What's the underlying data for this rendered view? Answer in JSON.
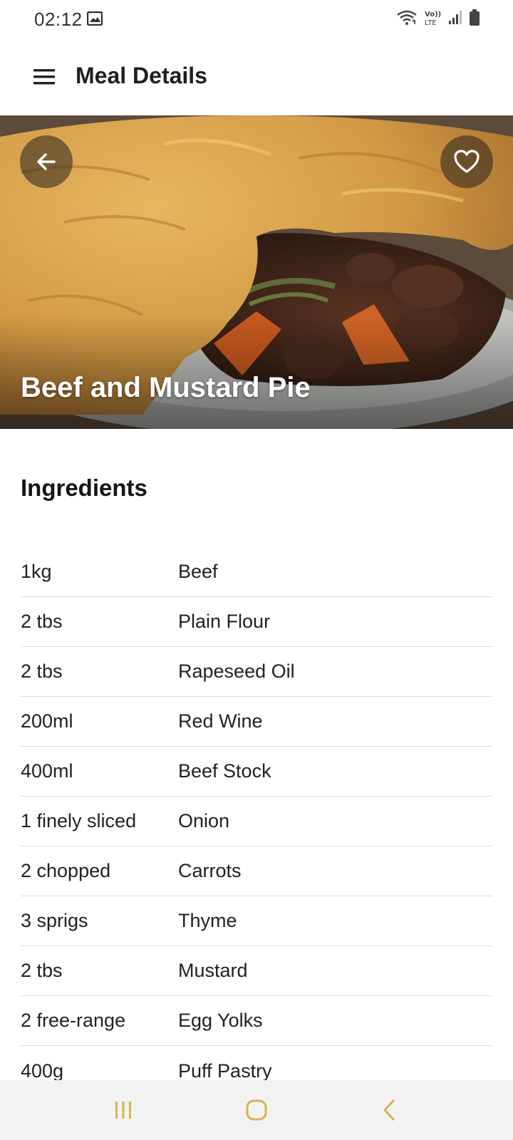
{
  "status_bar": {
    "time": "02:12",
    "icons": [
      "gallery-icon",
      "wifi-icon",
      "volte-icon",
      "signal-icon",
      "battery-icon"
    ],
    "volte_top": "Vo))",
    "volte_bottom": "LTE"
  },
  "app_bar": {
    "title": "Meal Details",
    "menu_icon": "hamburger-menu-icon"
  },
  "hero": {
    "meal_name": "Beef and Mustard Pie",
    "back_icon": "arrow-left-icon",
    "favorite_icon": "heart-outline-icon"
  },
  "ingredients": {
    "heading": "Ingredients",
    "rows": [
      {
        "measure": "1kg",
        "name": "Beef"
      },
      {
        "measure": "2 tbs",
        "name": "Plain Flour"
      },
      {
        "measure": "2 tbs",
        "name": "Rapeseed Oil"
      },
      {
        "measure": "200ml",
        "name": "Red Wine"
      },
      {
        "measure": "400ml",
        "name": "Beef Stock"
      },
      {
        "measure": "1 finely sliced",
        "name": "Onion"
      },
      {
        "measure": "2 chopped",
        "name": "Carrots"
      },
      {
        "measure": "3 sprigs",
        "name": "Thyme"
      },
      {
        "measure": "2 tbs",
        "name": "Mustard"
      },
      {
        "measure": "2 free-range",
        "name": "Egg Yolks"
      },
      {
        "measure": "400g",
        "name": "Puff Pastry"
      }
    ]
  },
  "nav_bar": {
    "icons": [
      "recent-apps-icon",
      "home-icon",
      "back-icon"
    ],
    "accent": "#d9b44a"
  }
}
